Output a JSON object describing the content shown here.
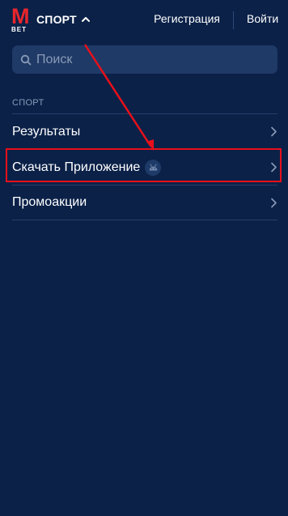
{
  "header": {
    "logo_letter": "M",
    "logo_sub": "BET",
    "sport_label": "СПОРТ",
    "register_label": "Регистрация",
    "login_label": "Войти"
  },
  "search": {
    "placeholder": "Поиск",
    "value": ""
  },
  "section": {
    "title": "СПОРТ",
    "items": [
      {
        "label": "Результаты"
      },
      {
        "label": "Скачать Приложение",
        "badge_icon": "android-icon"
      },
      {
        "label": "Промоакции"
      }
    ]
  },
  "colors": {
    "background": "#0b2148",
    "brand_red": "#e8262c",
    "search_bg": "#1f3a66",
    "muted_text": "#8a9bb8",
    "annotation_red": "#e8101a"
  },
  "icons": {
    "search": "search-icon",
    "expand": "chevron-up-icon",
    "row_arrow": "chevron-right-icon"
  }
}
